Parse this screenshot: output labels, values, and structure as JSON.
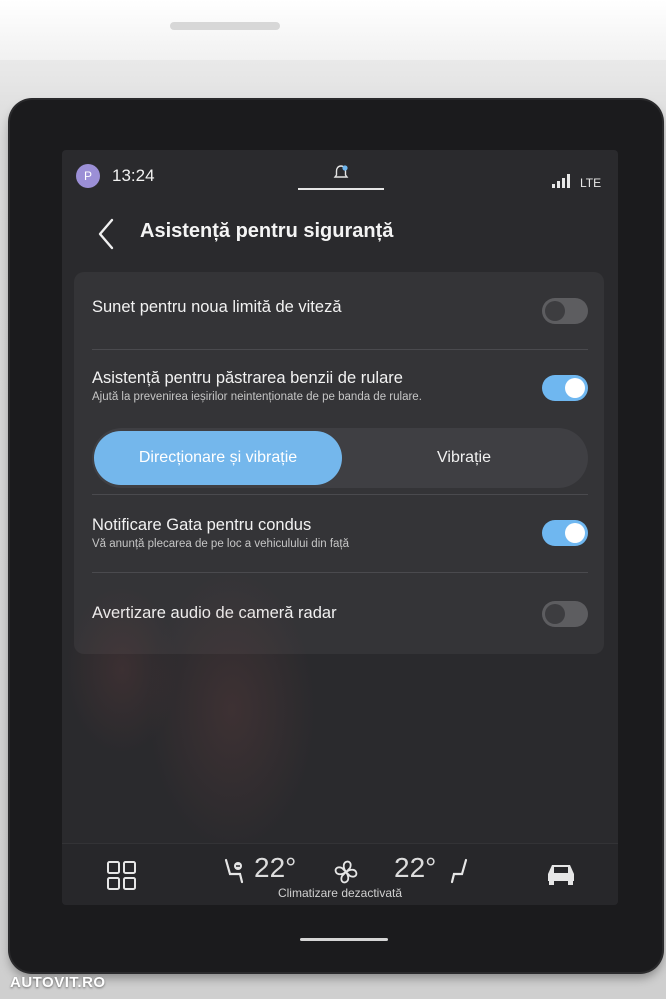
{
  "status_bar": {
    "avatar_initial": "P",
    "time": "13:24",
    "network": "LTE"
  },
  "header": {
    "back_icon": "chevron-left-icon",
    "title": "Asistență pentru siguranță"
  },
  "settings": [
    {
      "label": "Sunet pentru noua limită de viteză",
      "enabled": false
    },
    {
      "label": "Asistență pentru păstrarea benzii de rulare",
      "description": "Ajută la prevenirea ieșirilor neintenționate de pe banda de rulare.",
      "enabled": true
    },
    {
      "label": "Notificare Gata pentru condus",
      "description": "Vă anunță plecarea de pe loc a vehiculului din față",
      "enabled": true
    },
    {
      "label": "Avertizare audio de cameră radar",
      "enabled": false
    }
  ],
  "feedback_mode": {
    "options": [
      "Direcționare și vibrație",
      "Vibrație"
    ],
    "selected": "Direcționare și vibrație"
  },
  "climate": {
    "left_temp": "22°",
    "right_temp": "22°",
    "status": "Climatizare dezactivată"
  },
  "watermark": "AUTOVIT.RO",
  "colors": {
    "accent": "#74b7ec",
    "background": "#2a2a2d",
    "card": "#343437"
  }
}
